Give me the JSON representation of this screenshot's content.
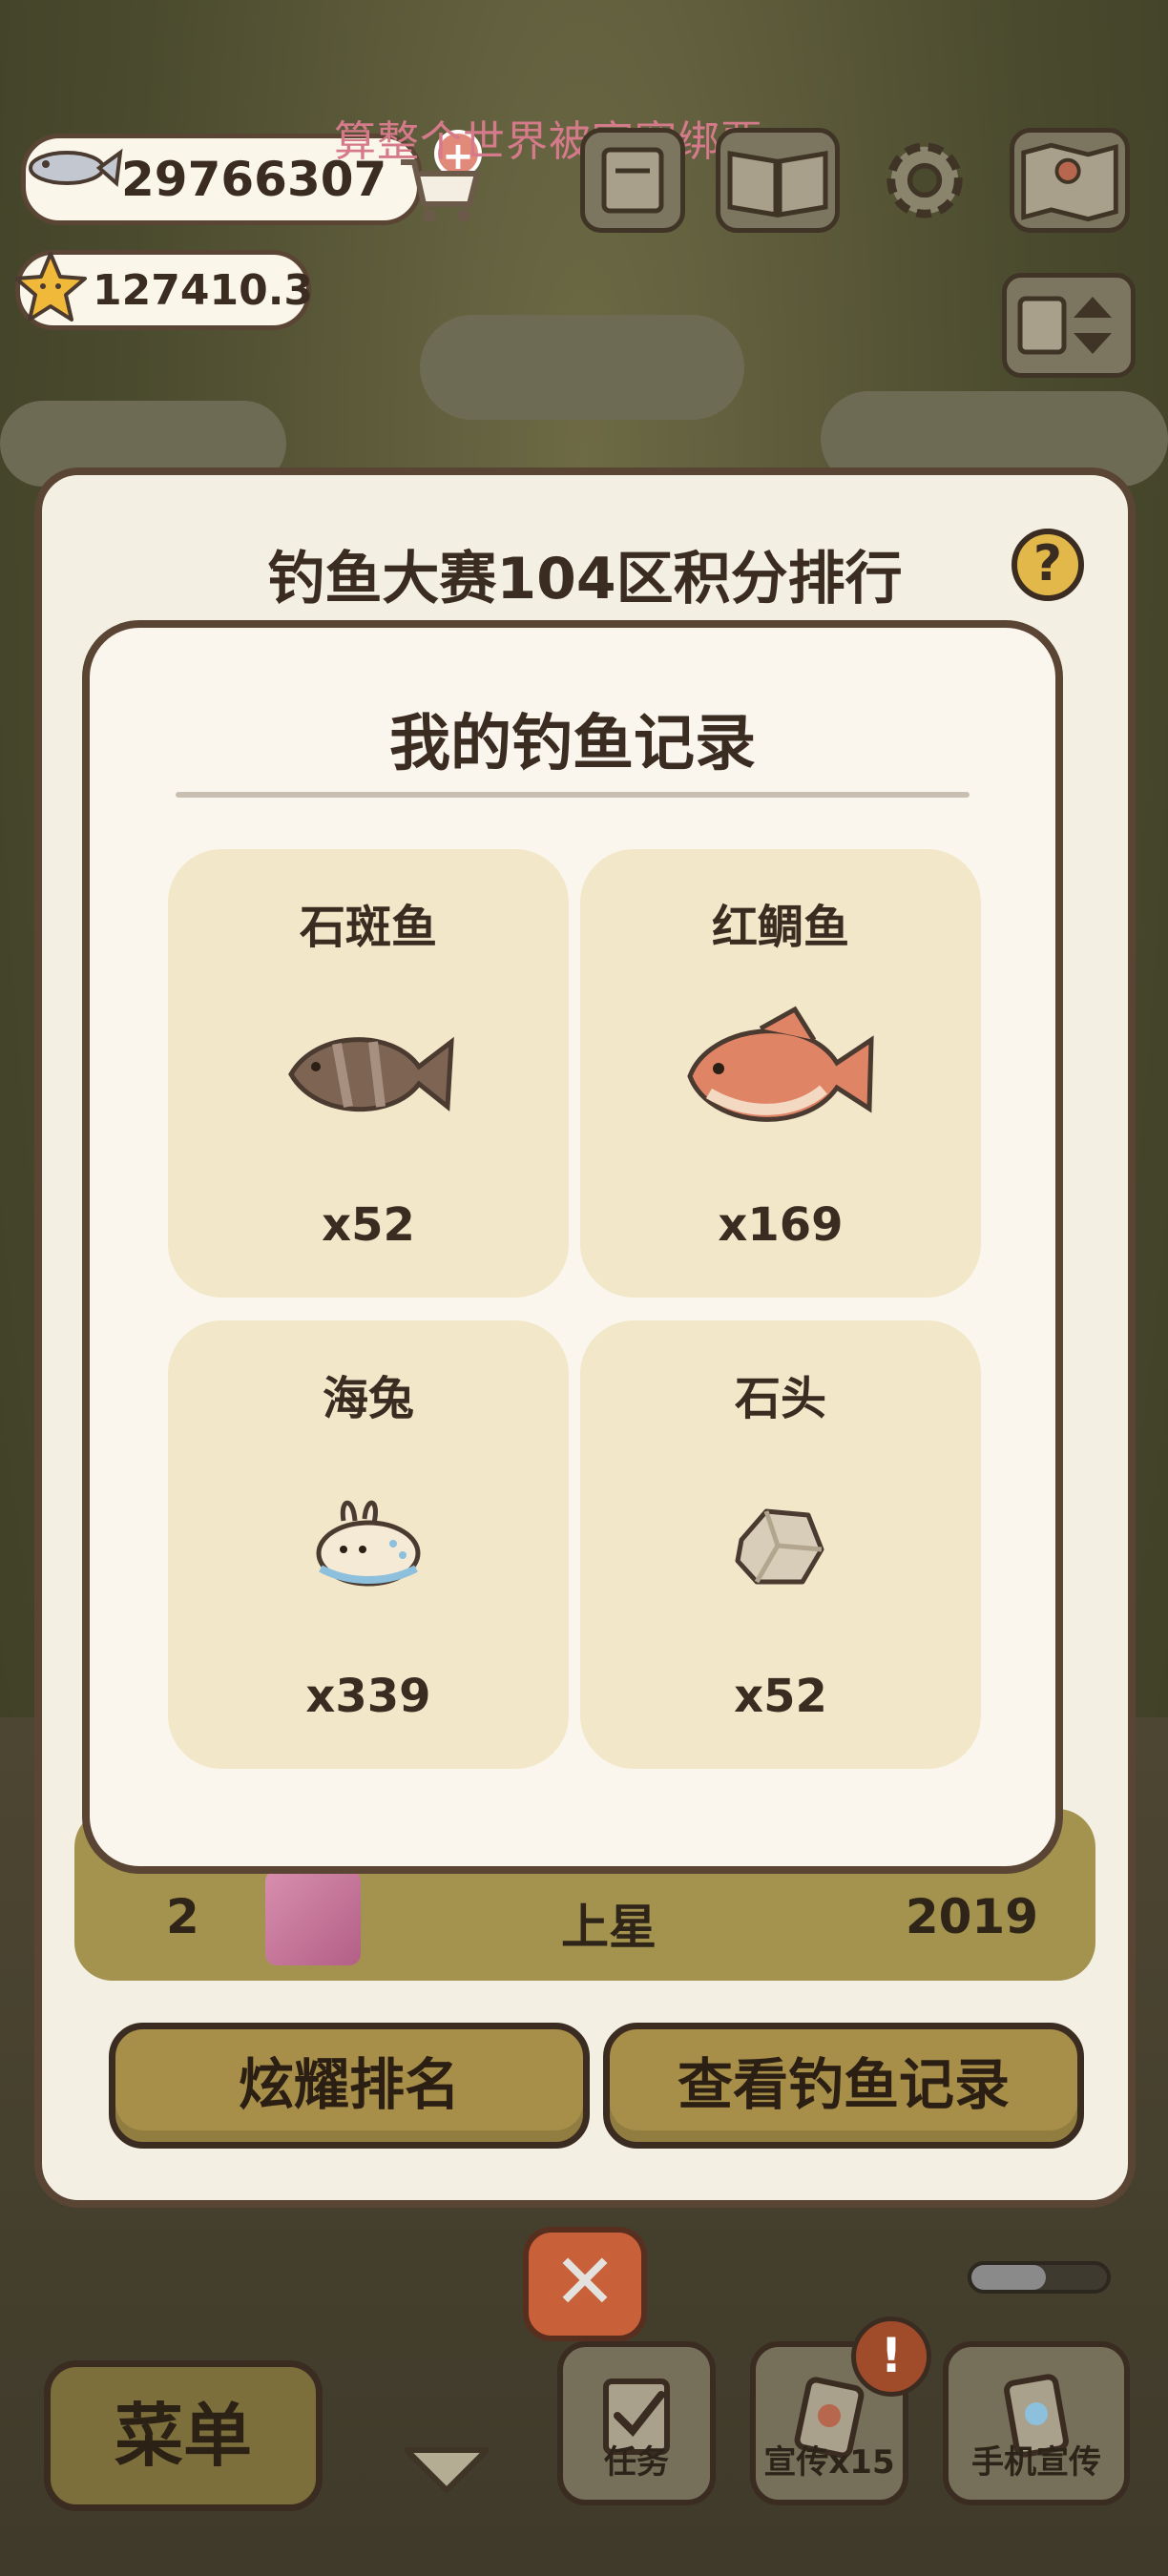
{
  "hud": {
    "fish_currency": "29766307",
    "star_currency": "127410.3",
    "banner_text": "算整个世界被寂寞绑票",
    "add_symbol": "+"
  },
  "ranking": {
    "title": "钓鱼大赛104区积分排行",
    "help_symbol": "?",
    "row": {
      "rank": "2",
      "name": "上星",
      "score": "2019"
    },
    "buttons": {
      "show_rank": "炫耀排名",
      "view_records": "查看钓鱼记录"
    }
  },
  "records": {
    "title": "我的钓鱼记录",
    "items": [
      {
        "name": "石斑鱼",
        "count": "x52",
        "icon": "grouper-fish-icon",
        "color": "#7e6553"
      },
      {
        "name": "红鲷鱼",
        "count": "x169",
        "icon": "red-snapper-fish-icon",
        "color": "#e08466"
      },
      {
        "name": "海兔",
        "count": "x339",
        "icon": "sea-bunny-icon",
        "color": "#f5ead6"
      },
      {
        "name": "石头",
        "count": "x52",
        "icon": "stone-icon",
        "color": "#d8cdb8"
      }
    ]
  },
  "bottom": {
    "close_symbol": "✕",
    "menu_label": "菜单",
    "tabs": [
      {
        "label": "任务",
        "icon": "checklist-icon"
      },
      {
        "label": "宣传x15",
        "icon": "promo-card-icon"
      },
      {
        "label": "手机宣传",
        "icon": "phone-promo-icon"
      }
    ],
    "alert_symbol": "!",
    "progress": 0.55
  },
  "colors": {
    "dialog_border": "#5a4534",
    "card_bg": "#f2e8c9",
    "button_gold": "#a78f4a",
    "close_orange": "#e0683c"
  }
}
